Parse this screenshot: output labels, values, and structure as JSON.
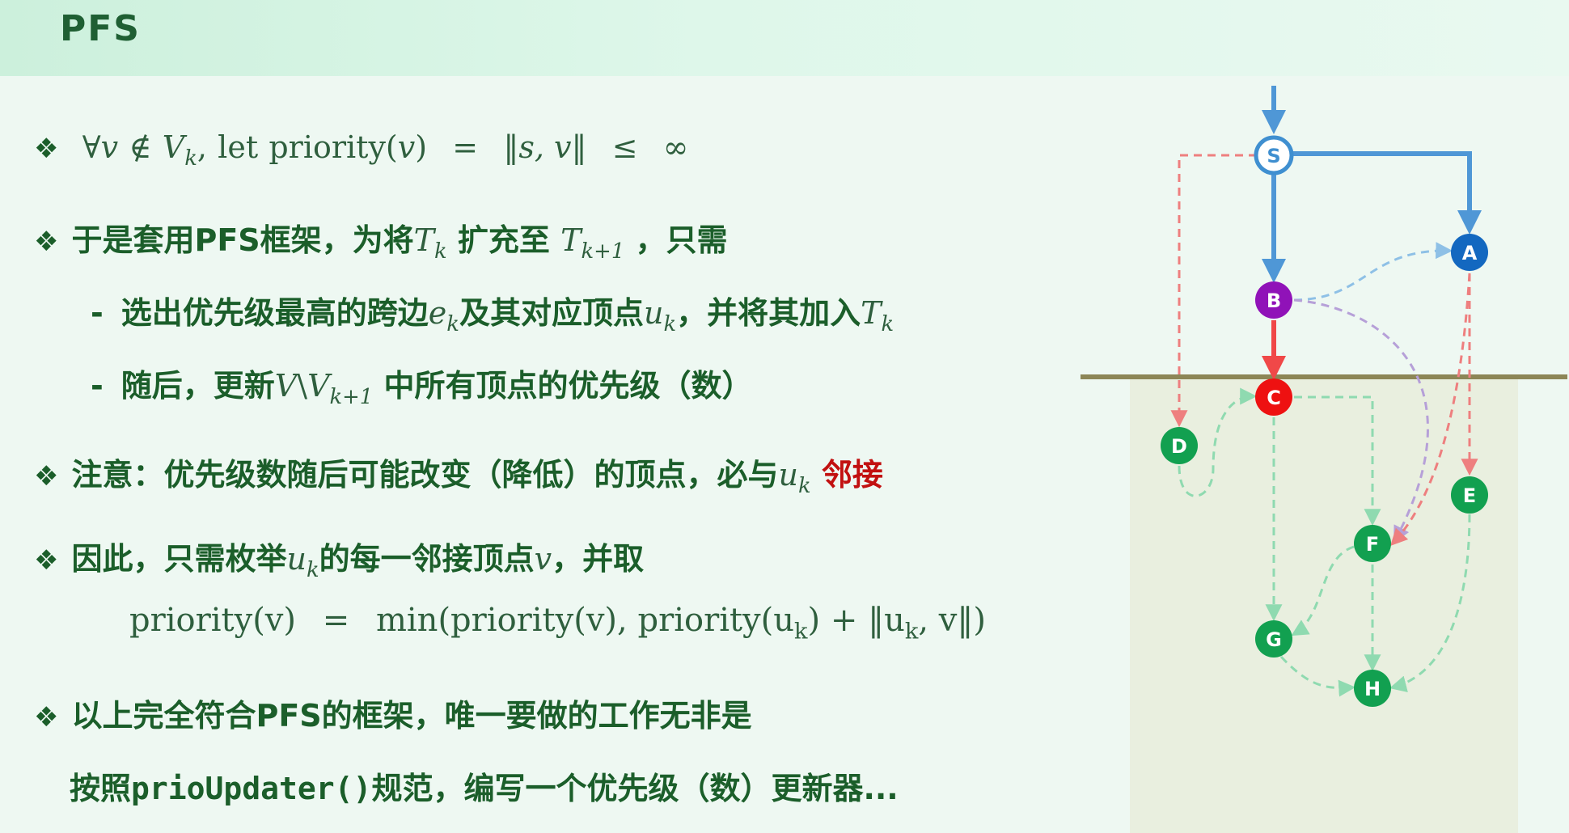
{
  "title": "PFS",
  "bullets": {
    "b1": {
      "forall": "∀",
      "v": "v",
      "notin": "∉",
      "Vk": "V",
      "Vk_sub": "k",
      "comma": ",",
      "let": "let",
      "priority": "priority(",
      "v2": "v",
      "close": ")",
      "eq": "=",
      "norm": "‖s, v‖",
      "le": "≤",
      "inf": "∞"
    },
    "b2": {
      "text1": "于是套用PFS框架，为将",
      "T": "T",
      "T_sub": "k",
      "text2": "扩充至",
      "T2": "T",
      "T2_sub": "k+1",
      "text3": "，只需"
    },
    "s1": {
      "dash": "-",
      "text1": "选出优先级最高的跨边",
      "e": "e",
      "e_sub": "k",
      "text2": "及其对应顶点",
      "u": "u",
      "u_sub": "k",
      "text3": "，并将其加入",
      "T": "T",
      "T_sub": "k"
    },
    "s2": {
      "dash": "-",
      "text1": "随后，更新",
      "V": "V",
      "bs": "\\",
      "V2": "V",
      "V2_sub": "k+1",
      "text2": "中所有顶点的优先级（数）"
    },
    "b3": {
      "text1": "注意：优先级数随后可能改变（降低）的顶点，必与",
      "u": "u",
      "u_sub": "k",
      "text2": "邻接"
    },
    "b4": {
      "text1": "因此，只需枚举",
      "u": "u",
      "u_sub": "k",
      "text2": "的每一邻接顶点",
      "v": "v",
      "text3": "，并取"
    },
    "formula": {
      "lhs": "priority(v)",
      "eq": "=",
      "rhs1": "min(priority(v), priority(u",
      "sub": "k",
      "rhs2": ") + ‖u",
      "sub2": "k",
      "rhs3": ", v‖)"
    },
    "b5": {
      "text": "以上完全符合PFS的框架，唯一要做的工作无非是"
    },
    "b6": {
      "text1": "按照",
      "code": "prioUpdater()",
      "text2": "规范，编写一个优先级（数）更新器..."
    }
  },
  "bullet_glyph": "❖",
  "graph": {
    "nodes": [
      "S",
      "A",
      "B",
      "C",
      "D",
      "E",
      "F",
      "G",
      "H"
    ],
    "colors": {
      "tree_edge": "#4f97d6",
      "crossing_edge": "#f04848",
      "light_blue": "#8ec0e6",
      "pink": "#ee7f7f",
      "purple_edge": "#b6a0d8",
      "green_edge": "#8fdab0",
      "cut_line": "#8c8656",
      "region": "#e9efdf",
      "node_S_fill": "#ffffff",
      "node_S_ring": "#3f8fd0",
      "node_A": "#1368c0",
      "node_B": "#9012b8",
      "node_C": "#ee1111",
      "node_green": "#12a050"
    }
  }
}
